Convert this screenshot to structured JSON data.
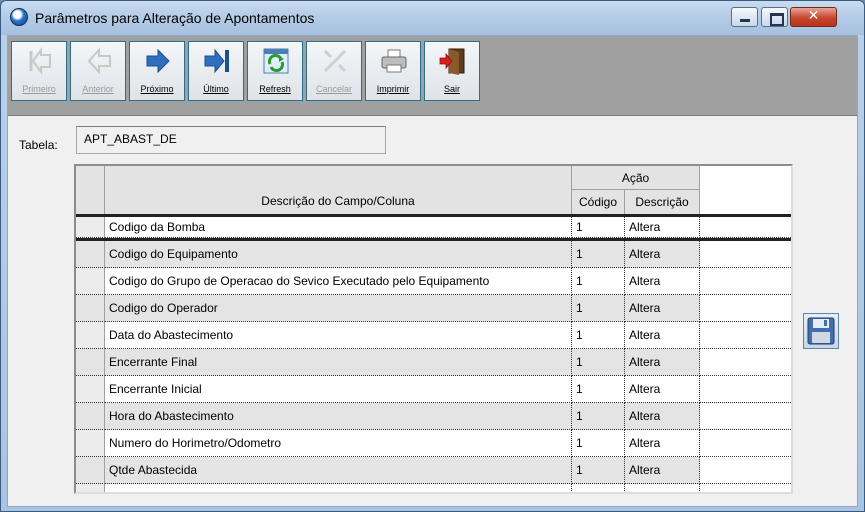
{
  "window": {
    "title": "Parâmetros para Alteração de Apontamentos",
    "close_glyph": "✕"
  },
  "toolbar": {
    "buttons": [
      {
        "label": "Primeiro",
        "icon": "first-record-icon",
        "enabled": false
      },
      {
        "label": "Anterior",
        "icon": "previous-record-icon",
        "enabled": false
      },
      {
        "label": "Próximo",
        "icon": "next-record-icon",
        "enabled": true
      },
      {
        "label": "Último",
        "icon": "last-record-icon",
        "enabled": true
      },
      {
        "label": "Refresh",
        "icon": "refresh-icon",
        "enabled": true
      },
      {
        "label": "Cancelar",
        "icon": "cancel-icon",
        "enabled": false
      },
      {
        "label": "Imprimir",
        "icon": "printer-icon",
        "enabled": true
      },
      {
        "label": "Sair",
        "icon": "exit-door-icon",
        "enabled": true
      }
    ]
  },
  "form": {
    "tabela_label": "Tabela:",
    "tabela_value": "APT_ABAST_DE"
  },
  "grid": {
    "header_desc": "Descrição do Campo/Coluna",
    "header_acao": "Ação",
    "header_codigo": "Código",
    "header_descricao": "Descrição",
    "rows": [
      {
        "campo": "Codigo da Bomba",
        "codigo": "1",
        "descricao": "Altera"
      },
      {
        "campo": "Codigo do Equipamento",
        "codigo": "1",
        "descricao": "Altera"
      },
      {
        "campo": "Codigo do Grupo de Operacao do Sevico Executado pelo Equipamento",
        "codigo": "1",
        "descricao": "Altera"
      },
      {
        "campo": "Codigo do Operador",
        "codigo": "1",
        "descricao": "Altera"
      },
      {
        "campo": "Data do Abastecimento",
        "codigo": "1",
        "descricao": "Altera"
      },
      {
        "campo": "Encerrante Final",
        "codigo": "1",
        "descricao": "Altera"
      },
      {
        "campo": "Encerrante Inicial",
        "codigo": "1",
        "descricao": "Altera"
      },
      {
        "campo": "Hora do Abastecimento",
        "codigo": "1",
        "descricao": "Altera"
      },
      {
        "campo": "Numero do Horimetro/Odometro",
        "codigo": "1",
        "descricao": "Altera"
      },
      {
        "campo": "Qtde Abastecida",
        "codigo": "1",
        "descricao": "Altera"
      }
    ]
  },
  "colors": {
    "toolbar_bg": "#a0a0a0",
    "button_border": "#2d6d8d",
    "alt_row": "#e4e4e4"
  }
}
